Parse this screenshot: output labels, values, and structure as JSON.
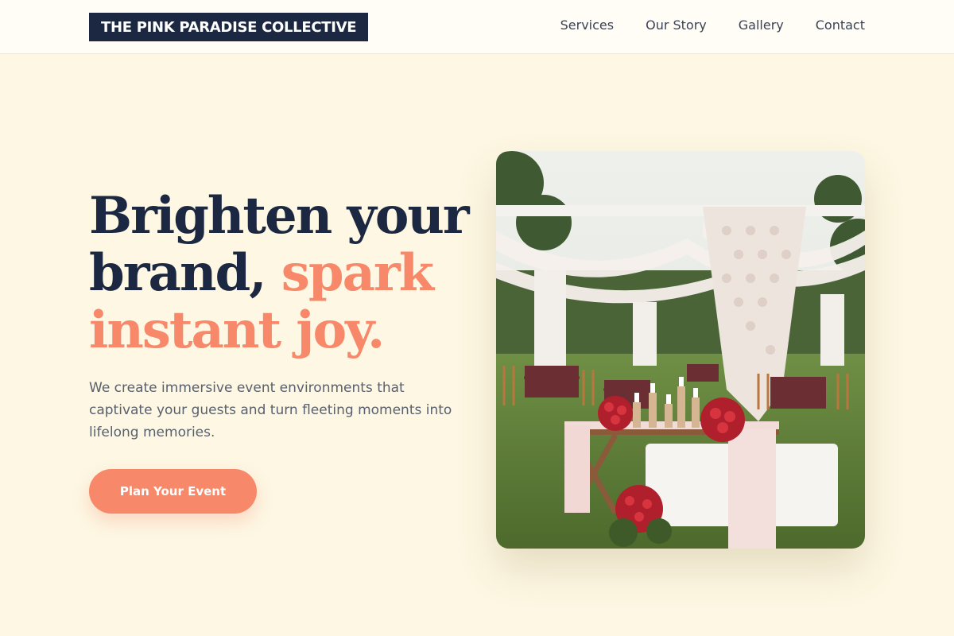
{
  "brand": {
    "name": "THE PINK PARADISE COLLECTIVE"
  },
  "nav": {
    "items": [
      {
        "label": "Services"
      },
      {
        "label": "Our Story"
      },
      {
        "label": "Gallery"
      },
      {
        "label": "Contact"
      }
    ]
  },
  "hero": {
    "headline_line1": "Brighten your",
    "headline_line2_a": "brand,",
    "headline_line2_b": "spark",
    "headline_line3": "instant joy.",
    "subtext": "We create immersive event environments that captivate your guests and turn fleeting moments into lifelong memories.",
    "cta_label": "Plan Your Event"
  },
  "colors": {
    "background": "#fdf7e3",
    "navy": "#1c2841",
    "accent": "#f7886a",
    "body_text": "#59606e"
  }
}
